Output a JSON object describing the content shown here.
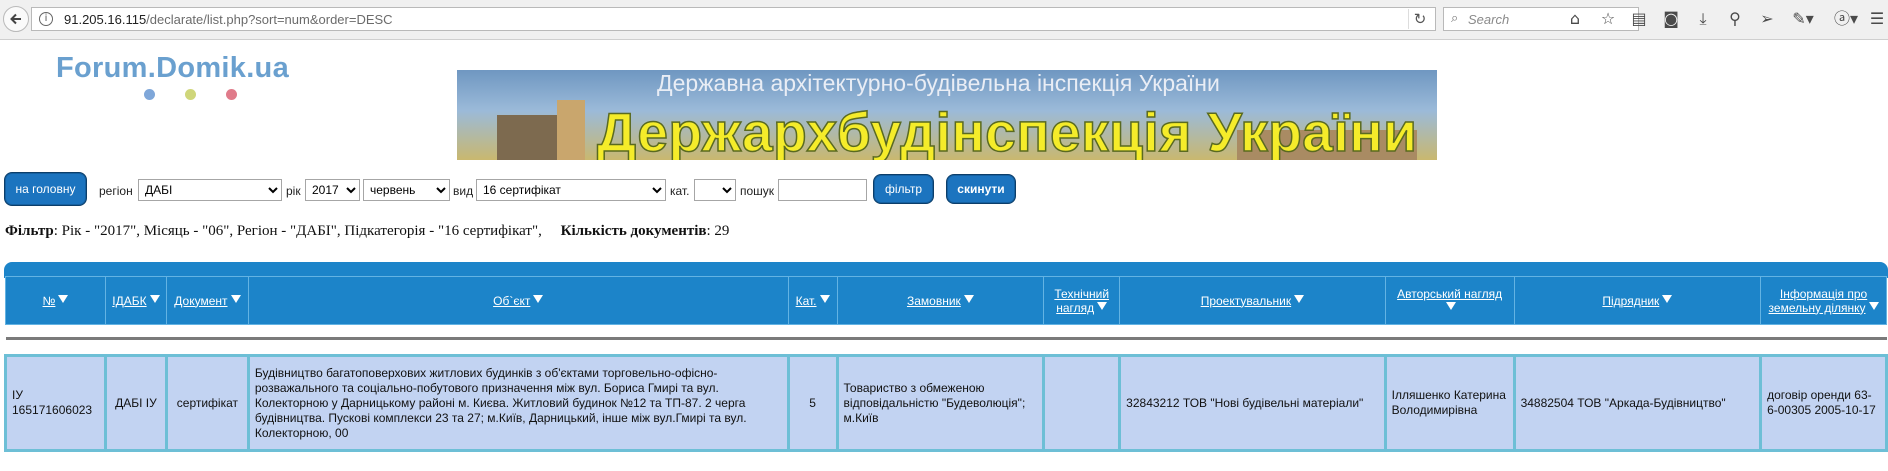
{
  "browser": {
    "url_host": "91.205.16.115",
    "url_path": "/declarate/list.php?sort=num&order=DESC",
    "search_placeholder": "Search"
  },
  "site": {
    "logo_text": "Forum.Domik.ua",
    "banner_subtitle": "Державна архітектурно-будівельна інспекція України",
    "banner_title": "Держархбудінспекція України"
  },
  "filters": {
    "home_button": "на головну",
    "region_label": "регіон",
    "region_value": "ДАБІ",
    "year_label": "рік",
    "year_value": "2017",
    "month_value": "червень",
    "type_label": "вид",
    "type_value": "16 сертифікат",
    "category_label": "кат.",
    "category_value": "",
    "search_label": "пошук",
    "search_value": "",
    "filter_button": "фільтр",
    "reset_button": "скинути"
  },
  "summary": {
    "filter_label": "Фільтр",
    "filter_text": ": Рік - \"2017\", Місяць - \"06\", Регіон - \"ДАБІ\", Підкатегорія - \"16 сертифікат\",",
    "count_label": "Кількість документів",
    "count_value": ": 29"
  },
  "table": {
    "columns": [
      "№",
      "ІДАБК",
      "Документ",
      "Об`єкт",
      "Кат.",
      "Замовник",
      "Технічний нагляд",
      "Проектувальник",
      "Авторський нагляд",
      "Підрядник",
      "Інформація про земельну ділянку"
    ],
    "rows": [
      {
        "num": "ІУ 165171606023",
        "idabk": "ДАБІ ІУ",
        "document": "сертифікат",
        "object": "Будівництво багатоповерхових житлових будинків з об'єктами торговельно-офісно-розважального та соціально-побутового призначення між вул. Бориса Гмирі та вул. Колекторною у Дарницькому районі м. Києва. Житловий будинок №12 та ТП-87. 2 черга будівництва. Пускові комплекси 23 та 27; м.Київ, Дарницький, інше між вул.Гмирі та вул. Колекторною, 00",
        "category": "5",
        "customer": "Товариство з обмеженою відповідальністю \"Будеволюція\"; м.Київ",
        "tech_supervision": "",
        "designer": "32843212 ТОВ \"Нові будівельні матеріали\"",
        "author_supervision": "Ілляшенко Катерина Володимирівна",
        "contractor": "34882504 ТОВ \"Аркада-Будівництво\"",
        "land_info": "договір оренди 63-6-00305 2005-10-17"
      }
    ]
  },
  "colors": {
    "accent": "#1c84c9",
    "row_bg": "#c2d3f2",
    "row_border": "#6dbfd6",
    "logo": "#6aa0cf",
    "banner_title": "#f5ec2a"
  }
}
